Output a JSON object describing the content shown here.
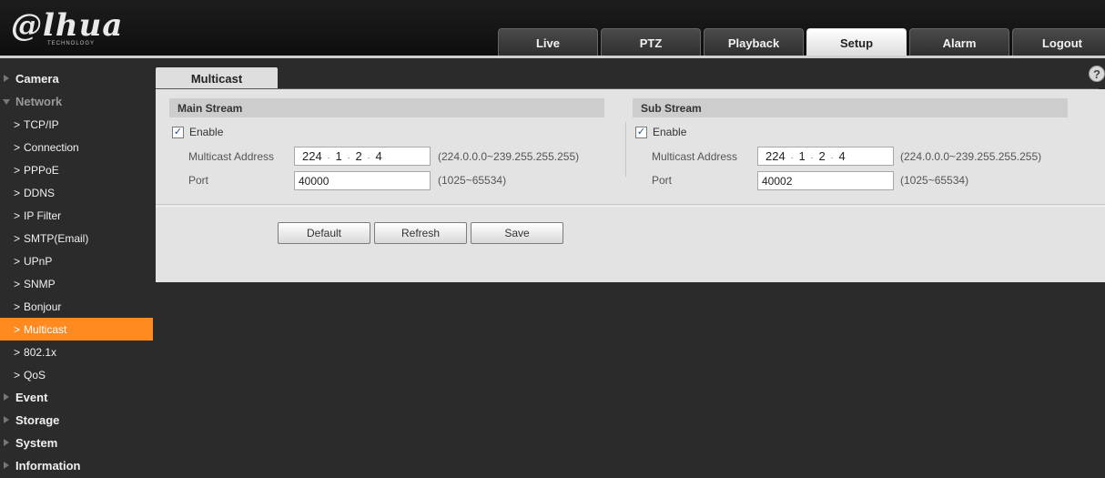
{
  "brand": {
    "logo": "@lhua",
    "tagline": "TECHNOLOGY"
  },
  "nav_tabs": [
    {
      "label": "Live",
      "active": false
    },
    {
      "label": "PTZ",
      "active": false
    },
    {
      "label": "Playback",
      "active": false
    },
    {
      "label": "Setup",
      "active": true
    },
    {
      "label": "Alarm",
      "active": false
    },
    {
      "label": "Logout",
      "active": false
    }
  ],
  "sidebar": {
    "camera": "Camera",
    "network": "Network",
    "network_items": [
      "TCP/IP",
      "Connection",
      "PPPoE",
      "DDNS",
      "IP Filter",
      "SMTP(Email)",
      "UPnP",
      "SNMP",
      "Bonjour",
      "Multicast",
      "802.1x",
      "QoS"
    ],
    "active_item": "Multicast",
    "event": "Event",
    "storage": "Storage",
    "system": "System",
    "information": "Information"
  },
  "page": {
    "tab_title": "Multicast",
    "help_glyph": "?"
  },
  "main_stream": {
    "title": "Main Stream",
    "enable_label": "Enable",
    "enabled": true,
    "address_label": "Multicast Address",
    "address": [
      "224",
      "1",
      "2",
      "4"
    ],
    "address_hint": "(224.0.0.0~239.255.255.255)",
    "port_label": "Port",
    "port": "40000",
    "port_hint": "(1025~65534)"
  },
  "sub_stream": {
    "title": "Sub Stream",
    "enable_label": "Enable",
    "enabled": true,
    "address_label": "Multicast Address",
    "address": [
      "224",
      "1",
      "2",
      "4"
    ],
    "address_hint": "(224.0.0.0~239.255.255.255)",
    "port_label": "Port",
    "port": "40002",
    "port_hint": "(1025~65534)"
  },
  "buttons": {
    "default": "Default",
    "refresh": "Refresh",
    "save": "Save"
  },
  "colors": {
    "accent": "#ff8a1f",
    "panel": "#e3e3e3",
    "background": "#2b2b2b"
  },
  "icons": {
    "check": "✓",
    "chevron": ">"
  }
}
